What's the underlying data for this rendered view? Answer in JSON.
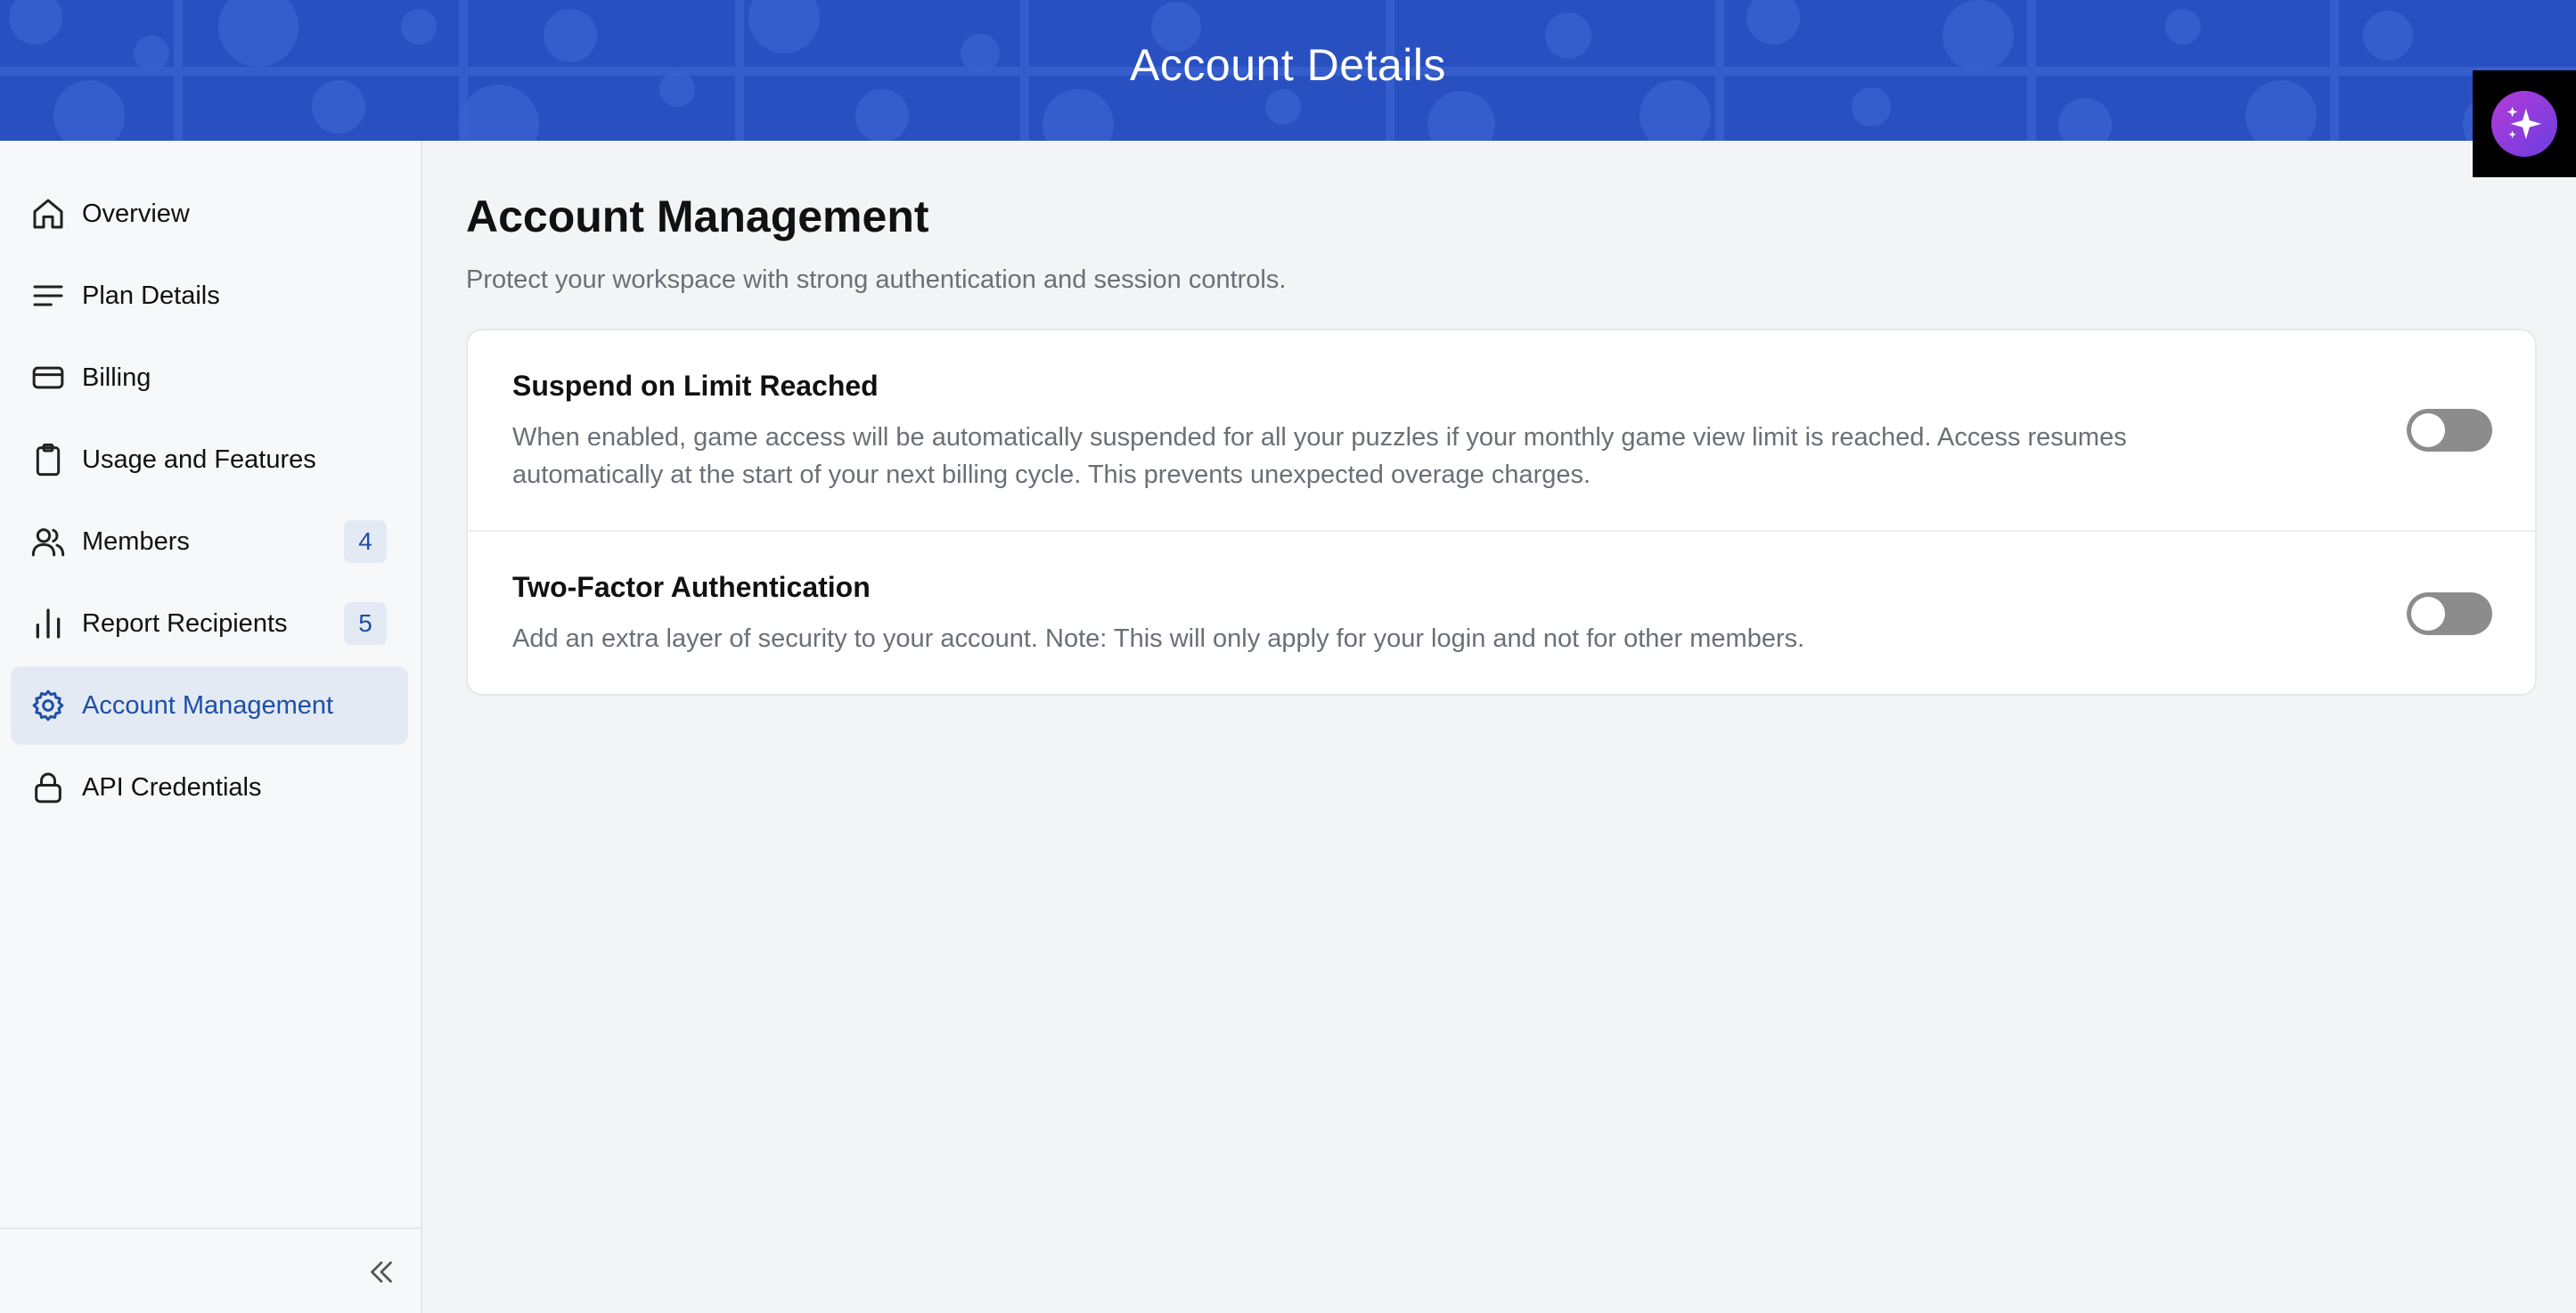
{
  "header": {
    "title": "Account Details"
  },
  "assistant_button": {
    "icon": "sparkles-icon"
  },
  "sidebar": {
    "items": [
      {
        "id": "overview",
        "label": "Overview",
        "icon": "home-icon",
        "badge": null,
        "active": false
      },
      {
        "id": "plan-details",
        "label": "Plan Details",
        "icon": "lines-icon",
        "badge": null,
        "active": false
      },
      {
        "id": "billing",
        "label": "Billing",
        "icon": "credit-card-icon",
        "badge": null,
        "active": false
      },
      {
        "id": "usage-and-features",
        "label": "Usage and Features",
        "icon": "clipboard-icon",
        "badge": null,
        "active": false
      },
      {
        "id": "members",
        "label": "Members",
        "icon": "users-icon",
        "badge": "4",
        "active": false
      },
      {
        "id": "report-recipients",
        "label": "Report Recipients",
        "icon": "bar-chart-icon",
        "badge": "5",
        "active": false
      },
      {
        "id": "account-management",
        "label": "Account Management",
        "icon": "gear-icon",
        "badge": null,
        "active": true
      },
      {
        "id": "api-credentials",
        "label": "API Credentials",
        "icon": "lock-icon",
        "badge": null,
        "active": false
      }
    ],
    "collapse_icon": "chevrons-left-icon"
  },
  "main": {
    "title": "Account Management",
    "subtitle": "Protect your workspace with strong authentication and session controls.",
    "settings": [
      {
        "title": "Suspend on Limit Reached",
        "description": "When enabled, game access will be automatically suspended for all your puzzles if your monthly game view limit is reached. Access resumes automatically at the start of your next billing cycle. This prevents unexpected overage charges.",
        "enabled": false
      },
      {
        "title": "Two-Factor Authentication",
        "description": "Add an extra layer of security to your account. Note: This will only apply for your login and not for other members.",
        "enabled": false
      }
    ]
  },
  "colors": {
    "header_bg": "#2850c0",
    "accent": "#1f4fa6",
    "active_bg": "#e3eaf3",
    "toggle_off": "#8c8c8c"
  }
}
